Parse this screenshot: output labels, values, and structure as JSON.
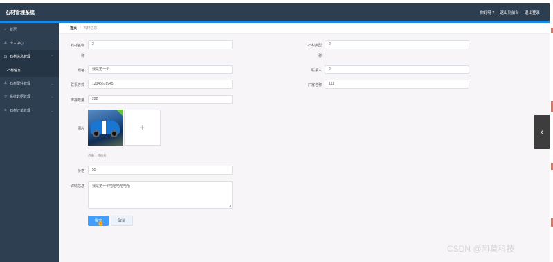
{
  "app": {
    "title": "石材管理系统",
    "header_links": [
      "你好呀 ?",
      "退出到前台",
      "退出登录"
    ]
  },
  "sidebar": {
    "items": [
      {
        "icon": "home-icon",
        "glyph": "⌂",
        "label": "首页",
        "chevron": false
      },
      {
        "icon": "user-icon",
        "glyph": "♙",
        "label": "个人中心",
        "chevron": true
      },
      {
        "icon": "list-icon",
        "glyph": "▭",
        "label": "石材信息管理",
        "chevron": true
      },
      {
        "icon": "",
        "glyph": "",
        "label": "石材信息",
        "chevron": false,
        "sub": true
      },
      {
        "icon": "user-group-icon",
        "glyph": "♙",
        "label": "石材配件管理",
        "chevron": true
      },
      {
        "icon": "filter-icon",
        "glyph": "▽",
        "label": "系统数据管理",
        "chevron": true
      },
      {
        "icon": "menu-icon",
        "glyph": "≡",
        "label": "石材订单管理",
        "chevron": true
      }
    ]
  },
  "breadcrumb": {
    "home": "首页",
    "separator": "/",
    "current": "石材信息"
  },
  "form": {
    "row1_left_label_line1": "石材名称",
    "row1_left_label_line2": "称",
    "row1_left_value": "2",
    "row1_right_label_line1": "石材类型",
    "row1_right_label_line2": "称",
    "row1_right_value": "2",
    "row2_left_label": "规格",
    "row2_left_value": "我是第一个",
    "row2_right_label": "联系人",
    "row2_right_value": "2",
    "row3_left_label": "联系方式",
    "row3_left_value": "12345678945",
    "row3_right_label": "厂家名称",
    "row3_right_value": "111",
    "row4_left_label": "库存数量",
    "row4_left_value": "222",
    "image_label": "图片",
    "upload_plus": "+",
    "upload_hint": "点击上传图片",
    "price_label": "价格",
    "price_value": "55",
    "detail_label": "详情信息",
    "detail_value": "我是第一个啦哈哈哈哈哈",
    "submit_label": "提交",
    "cancel_label": "取消"
  },
  "floating_tab_glyph": "‹",
  "watermark": "CSDN @阿莫科技",
  "colors": {
    "topbar": "#2d3e50",
    "accent_line": "#1e88e5",
    "sidebar": "#2f3f52",
    "primary_button": "#409eff"
  }
}
